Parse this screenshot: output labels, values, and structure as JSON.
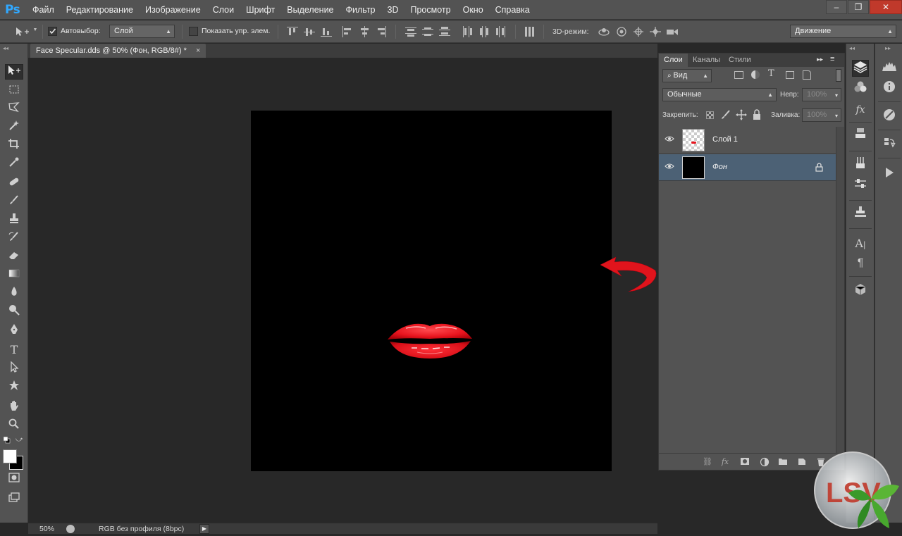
{
  "app": {
    "logo": "Ps"
  },
  "menu": [
    "Файл",
    "Редактирование",
    "Изображение",
    "Слои",
    "Шрифт",
    "Выделение",
    "Фильтр",
    "3D",
    "Просмотр",
    "Окно",
    "Справка"
  ],
  "window_controls": [
    "–",
    "❐",
    "✕"
  ],
  "options": {
    "autoselect_label": "Автовыбор:",
    "autoselect_checked": true,
    "autoselect_target": "Слой",
    "show_transform_label": "Показать упр. элем.",
    "mode3d_label": "3D-режим:",
    "workspace": "Движение"
  },
  "document": {
    "tab_title": "Face Specular.dds @ 50% (Фон, RGB/8#) *",
    "tab_close": "×"
  },
  "status": {
    "zoom": "50%",
    "profile": "RGB без профиля (8bpc)"
  },
  "layers_panel": {
    "tabs": [
      "Слои",
      "Каналы",
      "Стили"
    ],
    "active_tab": "Слои",
    "filter_label": "Вид",
    "blend_mode": "Обычные",
    "opacity_label": "Непр:",
    "opacity_value": "100%",
    "lock_label": "Закрепить:",
    "fill_label": "Заливка:",
    "fill_value": "100%",
    "layers": [
      {
        "name": "Слой 1",
        "visible": true,
        "selected": false,
        "thumbnail": "transparent-with-lips"
      },
      {
        "name": "Фон",
        "visible": true,
        "selected": true,
        "locked": true,
        "thumbnail": "black"
      }
    ]
  },
  "watermark": {
    "text": "LSV"
  },
  "colors": {
    "accent_blue": "#31a8ff",
    "selected_layer": "#4c6175",
    "arrow_red": "#e0141c",
    "lips_red": "#e8141e"
  },
  "icons": {
    "toolbar": [
      "move-tool-icon",
      "marquee-tool-icon",
      "lasso-tool-icon",
      "magic-wand-icon",
      "crop-tool-icon",
      "eyedropper-icon",
      "healing-brush-icon",
      "brush-tool-icon",
      "clone-stamp-icon",
      "history-brush-icon",
      "eraser-icon",
      "gradient-icon",
      "blur-icon",
      "dodge-icon",
      "pen-tool-icon",
      "type-tool-icon",
      "path-selection-icon",
      "custom-shape-icon",
      "hand-tool-icon",
      "zoom-tool-icon"
    ]
  }
}
